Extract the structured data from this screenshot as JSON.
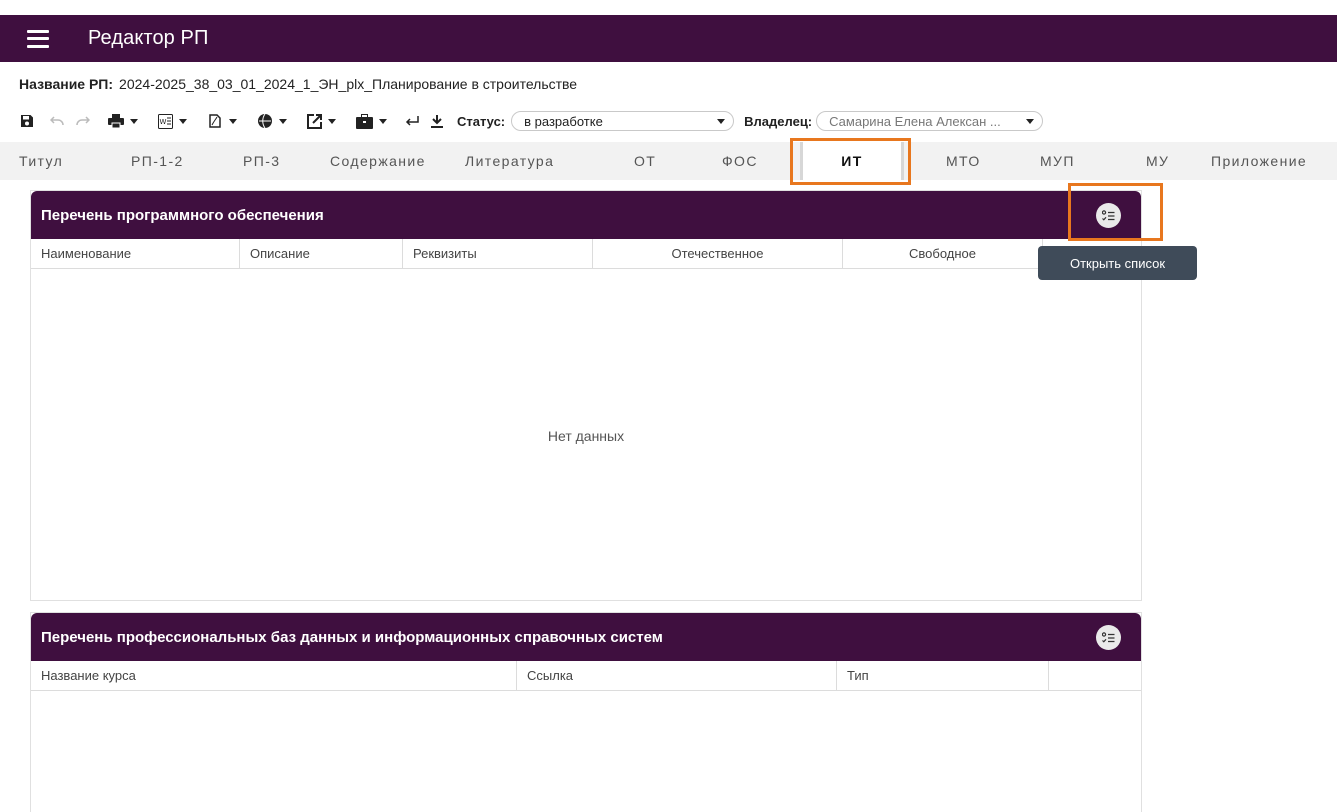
{
  "app": {
    "title": "Редактор РП"
  },
  "rp": {
    "label": "Название РП:",
    "value": "2024-2025_38_03_01_2024_1_ЭН_plx_Планирование в строительстве"
  },
  "toolbar": {
    "icons": [
      "save-icon",
      "undo-icon",
      "redo-icon",
      "print-icon",
      "word-icon",
      "pdf-icon",
      "globe-icon",
      "export-icon",
      "briefcase-icon",
      "return-icon",
      "download-icon"
    ],
    "status_label": "Статус:",
    "status_value": "в разработке",
    "owner_label": "Владелец:",
    "owner_value": "Самарина Елена Алексан ..."
  },
  "tabs": [
    {
      "label": "Титул"
    },
    {
      "label": "РП-1-2"
    },
    {
      "label": "РП-3"
    },
    {
      "label": "Содержание"
    },
    {
      "label": "Литература"
    },
    {
      "label": "ОТ"
    },
    {
      "label": "ФОС"
    },
    {
      "label": "ИТ",
      "active": true
    },
    {
      "label": "МТО"
    },
    {
      "label": "МУП"
    },
    {
      "label": "МУ"
    },
    {
      "label": "Приложение"
    }
  ],
  "software_panel": {
    "title": "Перечень программного обеспечения",
    "columns": [
      "Наименование",
      "Описание",
      "Реквизиты",
      "Отечественное",
      "Свободное"
    ],
    "empty_text": "Нет данных",
    "button_icon": "checklist-icon"
  },
  "tooltip": {
    "text": "Открыть список"
  },
  "databases_panel": {
    "title": "Перечень профессиональных баз данных и информационных справочных систем",
    "columns": [
      "Название курса",
      "Ссылка",
      "Тип"
    ],
    "button_icon": "checklist-icon"
  },
  "colors": {
    "header": "#3f0f3f",
    "highlight": "#e8771e",
    "tooltip": "#3f4b59"
  }
}
